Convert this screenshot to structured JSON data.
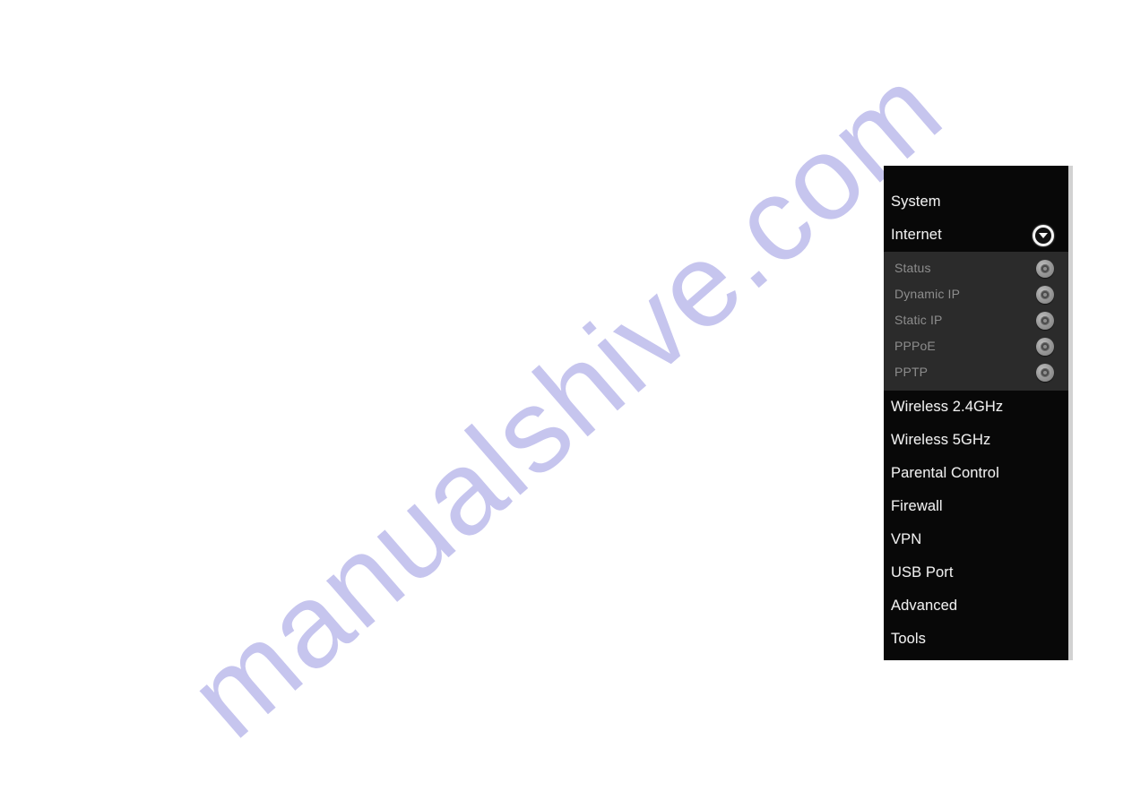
{
  "page": {
    "background_color": "#ffffff",
    "watermark": {
      "text": "manualshive.com",
      "color": "#c6c5ee",
      "rotation_deg": -41
    }
  },
  "nav_panel": {
    "background_color": "#080808",
    "submenu_background_color": "#2b2b2b",
    "border_color": "#d2d2d2",
    "items": [
      {
        "label": "System",
        "expandable": false,
        "expanded": false,
        "icon": null
      },
      {
        "label": "Internet",
        "expandable": true,
        "expanded": true,
        "icon": "chevron-down-icon",
        "subitems": [
          {
            "label": "Status",
            "icon": "radio-disc-icon"
          },
          {
            "label": "Dynamic IP",
            "icon": "radio-disc-icon"
          },
          {
            "label": "Static IP",
            "icon": "radio-disc-icon"
          },
          {
            "label": "PPPoE",
            "icon": "radio-disc-icon"
          },
          {
            "label": "PPTP",
            "icon": "radio-disc-icon"
          }
        ]
      },
      {
        "label": "Wireless 2.4GHz",
        "expandable": false,
        "expanded": false,
        "icon": null
      },
      {
        "label": "Wireless 5GHz",
        "expandable": false,
        "expanded": false,
        "icon": null
      },
      {
        "label": "Parental Control",
        "expandable": false,
        "expanded": false,
        "icon": null
      },
      {
        "label": "Firewall",
        "expandable": false,
        "expanded": false,
        "icon": null
      },
      {
        "label": "VPN",
        "expandable": false,
        "expanded": false,
        "icon": null
      },
      {
        "label": "USB Port",
        "expandable": false,
        "expanded": false,
        "icon": null
      },
      {
        "label": "Advanced",
        "expandable": false,
        "expanded": false,
        "icon": null
      },
      {
        "label": "Tools",
        "expandable": false,
        "expanded": false,
        "icon": null
      }
    ]
  }
}
